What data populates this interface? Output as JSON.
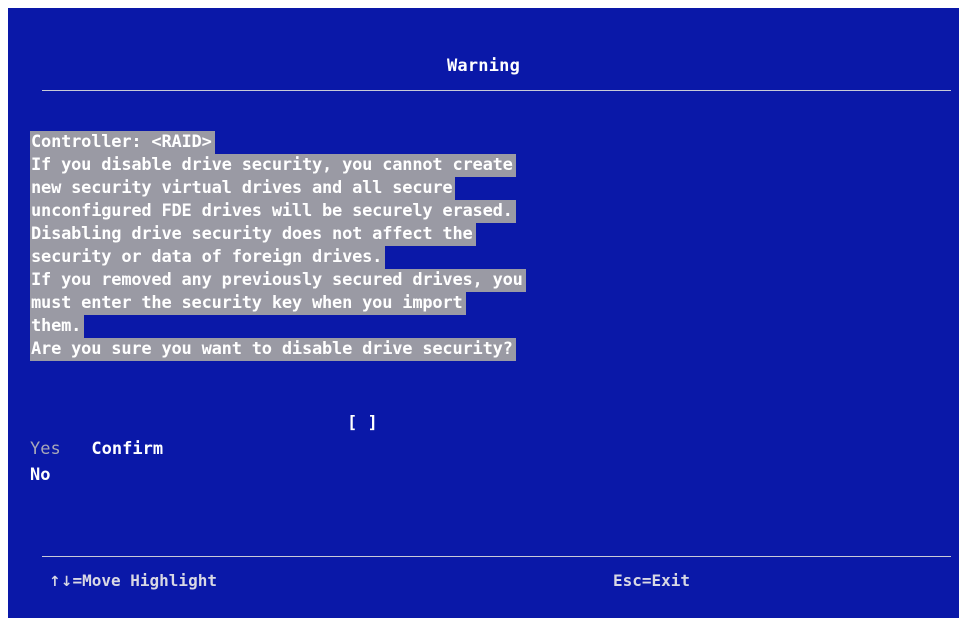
{
  "dialog": {
    "title": "Warning"
  },
  "message": {
    "lines": [
      "Controller: <RAID>",
      "If you disable drive security, you cannot create",
      "new security virtual drives and all secure",
      "unconfigured FDE drives will be securely erased.",
      "Disabling drive security does not affect the",
      "security or data of foreign drives.",
      "If you removed any previously secured drives, you",
      "must enter the security key when you import",
      "them.",
      "Are you sure you want to disable drive security?"
    ]
  },
  "options": {
    "confirm_label": "Confirm",
    "confirm_value": "[ ]",
    "yes_label": "Yes",
    "no_label": "No"
  },
  "footer": {
    "move_hint_arrows": "↑↓",
    "move_hint_text": "=Move Highlight",
    "exit_hint": "Esc=Exit"
  },
  "colors": {
    "background": "#0a18a8",
    "highlight": "#9a9aa4",
    "text": "#ffffff",
    "disabled_text": "#a8a8b8"
  }
}
